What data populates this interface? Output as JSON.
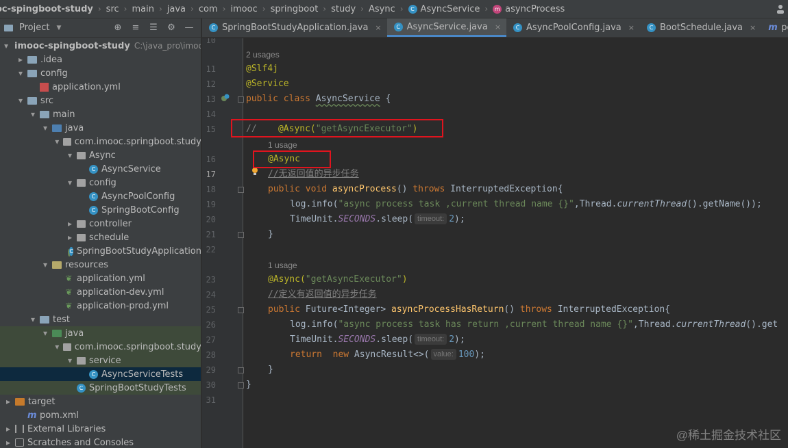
{
  "breadcrumb": [
    {
      "label": "oc-spingboot-study",
      "icon": "none"
    },
    {
      "label": "src",
      "icon": "none"
    },
    {
      "label": "main",
      "icon": "none"
    },
    {
      "label": "java",
      "icon": "none"
    },
    {
      "label": "com",
      "icon": "none"
    },
    {
      "label": "imooc",
      "icon": "none"
    },
    {
      "label": "springboot",
      "icon": "none"
    },
    {
      "label": "study",
      "icon": "none"
    },
    {
      "label": "Async",
      "icon": "none"
    },
    {
      "label": "AsyncService",
      "icon": "class-icon"
    },
    {
      "label": "asyncProcess",
      "icon": "method-icon"
    }
  ],
  "project_panel": {
    "title": "Project",
    "tree": [
      {
        "label": "imooc-spingboot-study",
        "path": "C:\\java_pro\\imooc-s",
        "depth": 0,
        "expanded": true,
        "icon": "folder",
        "bold": true
      },
      {
        "label": ".idea",
        "depth": 1,
        "expanded": false,
        "icon": "folder"
      },
      {
        "label": "config",
        "depth": 1,
        "expanded": true,
        "icon": "folder"
      },
      {
        "label": "application.yml",
        "depth": 2,
        "icon": "yml-file"
      },
      {
        "label": "src",
        "depth": 1,
        "expanded": true,
        "icon": "folder"
      },
      {
        "label": "main",
        "depth": 2,
        "expanded": true,
        "icon": "folder"
      },
      {
        "label": "java",
        "depth": 3,
        "expanded": true,
        "icon": "source-folder"
      },
      {
        "label": "com.imooc.springboot.study",
        "depth": 4,
        "expanded": true,
        "icon": "package"
      },
      {
        "label": "Async",
        "depth": 5,
        "expanded": true,
        "icon": "package"
      },
      {
        "label": "AsyncService",
        "depth": 6,
        "icon": "class"
      },
      {
        "label": "config",
        "depth": 5,
        "expanded": true,
        "icon": "package"
      },
      {
        "label": "AsyncPoolConfig",
        "depth": 6,
        "icon": "class"
      },
      {
        "label": "SpringBootConfig",
        "depth": 6,
        "icon": "class"
      },
      {
        "label": "controller",
        "depth": 5,
        "expanded": false,
        "icon": "package"
      },
      {
        "label": "schedule",
        "depth": 5,
        "expanded": false,
        "icon": "package"
      },
      {
        "label": "SpringBootStudyApplication",
        "depth": 5,
        "icon": "spring-class"
      },
      {
        "label": "resources",
        "depth": 3,
        "expanded": true,
        "icon": "resource-folder"
      },
      {
        "label": "application.yml",
        "depth": 4,
        "icon": "spring-yml"
      },
      {
        "label": "application-dev.yml",
        "depth": 4,
        "icon": "spring-yml"
      },
      {
        "label": "application-prod.yml",
        "depth": 4,
        "icon": "spring-yml"
      },
      {
        "label": "test",
        "depth": 2,
        "expanded": true,
        "icon": "folder"
      },
      {
        "label": "java",
        "depth": 3,
        "expanded": true,
        "icon": "test-folder",
        "scope": true
      },
      {
        "label": "com.imooc.springboot.study",
        "depth": 4,
        "expanded": true,
        "icon": "package",
        "scope": true
      },
      {
        "label": "service",
        "depth": 5,
        "expanded": true,
        "icon": "package",
        "scope": true
      },
      {
        "label": "AsyncServiceTests",
        "depth": 6,
        "icon": "class",
        "selected": true
      },
      {
        "label": "SpringBootStudyTests",
        "depth": 5,
        "icon": "class",
        "scope": true
      },
      {
        "label": "target",
        "depth": 0,
        "expanded": false,
        "icon": "excluded-folder"
      },
      {
        "label": "pom.xml",
        "depth": 1,
        "icon": "maven"
      },
      {
        "label": "External Libraries",
        "depth": 0,
        "expanded": false,
        "icon": "library"
      },
      {
        "label": "Scratches and Consoles",
        "depth": 0,
        "expanded": false,
        "icon": "scratches"
      }
    ]
  },
  "tabs": [
    {
      "label": "SpringBootStudyApplication.java",
      "icon": "class",
      "active": false
    },
    {
      "label": "AsyncService.java",
      "icon": "class",
      "active": true
    },
    {
      "label": "AsyncPoolConfig.java",
      "icon": "class",
      "active": false
    },
    {
      "label": "BootSchedule.java",
      "icon": "class",
      "active": false
    },
    {
      "label": "pom.xml (imooc-sp",
      "icon": "maven",
      "active": false
    }
  ],
  "editor": {
    "current_line": 17,
    "line_numbers": [
      "10",
      "11",
      "12",
      "13",
      "14",
      "15",
      "16",
      "17",
      "18",
      "19",
      "20",
      "21",
      "22",
      "23",
      "24",
      "25",
      "26",
      "27",
      "28",
      "29",
      "30",
      "31"
    ],
    "hints": [
      "2 usages",
      "1 usage",
      "1 usage"
    ],
    "code": {
      "l11": "@Slf4j",
      "l12": "@Service",
      "l13_kw": "public class ",
      "l13_name": "AsyncService",
      "l13_rest": " {",
      "l15_cm": "//    ",
      "l15_an": "@Async(",
      "l15_str": "\"getAsyncExecutor\"",
      "l15_end": ")",
      "l16": "@Async",
      "l17": "//无返回值的异步任务",
      "l18_kw1": "public void ",
      "l18_fn": "asyncProcess",
      "l18_mid": "() ",
      "l18_kw2": "throws ",
      "l18_rest": "InterruptedException{",
      "l19_a": "log.info(",
      "l19_str": "\"async process task ,current thread name {}\"",
      "l19_b": ",Thread.",
      "l19_it": "currentThread",
      "l19_c": "().getName());",
      "l20_a": "TimeUnit.",
      "l20_fld": "SECONDS",
      "l20_b": ".sleep(",
      "l20_ph": "timeout:",
      "l20_num": "2",
      "l20_c": ");",
      "l21": "}",
      "l23_an": "@Async(",
      "l23_str": "\"getAsyncExecutor\"",
      "l23_end": ")",
      "l24": "//定义有返回值的异步任务",
      "l25_kw1": "public ",
      "l25_a": "Future<Integer> ",
      "l25_fn": "asyncProcessHasReturn",
      "l25_mid": "() ",
      "l25_kw2": "throws ",
      "l25_rest": "InterruptedException{",
      "l26_a": "log.info(",
      "l26_str": "\"async process task has return ,current thread name {}\"",
      "l26_b": ",Thread.",
      "l26_it": "currentThread",
      "l26_c": "().get",
      "l27_a": "TimeUnit.",
      "l27_fld": "SECONDS",
      "l27_b": ".sleep(",
      "l27_ph": "timeout:",
      "l27_num": "2",
      "l27_c": ");",
      "l28_kw": "return  new ",
      "l28_a": "AsyncResult<>(",
      "l28_ph": "value:",
      "l28_num": "100",
      "l28_c": ");",
      "l29": "}",
      "l30": "}"
    }
  },
  "watermark": "@稀土掘金技术社区",
  "colors": {
    "highlight_box": "#e0141e",
    "selection": "#0d293e",
    "accent": "#4a88c7"
  }
}
